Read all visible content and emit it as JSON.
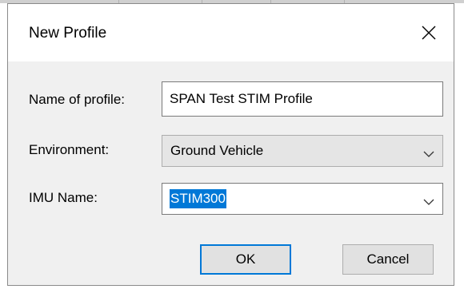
{
  "dialog": {
    "title": "New Profile",
    "close_icon": "close-icon"
  },
  "form": {
    "name_label": "Name of profile:",
    "name_value": "SPAN Test STIM Profile",
    "environment_label": "Environment:",
    "environment_value": "Ground Vehicle",
    "imu_label": "IMU Name:",
    "imu_value": "STIM300"
  },
  "buttons": {
    "ok_label": "OK",
    "cancel_label": "Cancel"
  },
  "colors": {
    "accent": "#0078d7",
    "selection": "#0078d7"
  }
}
